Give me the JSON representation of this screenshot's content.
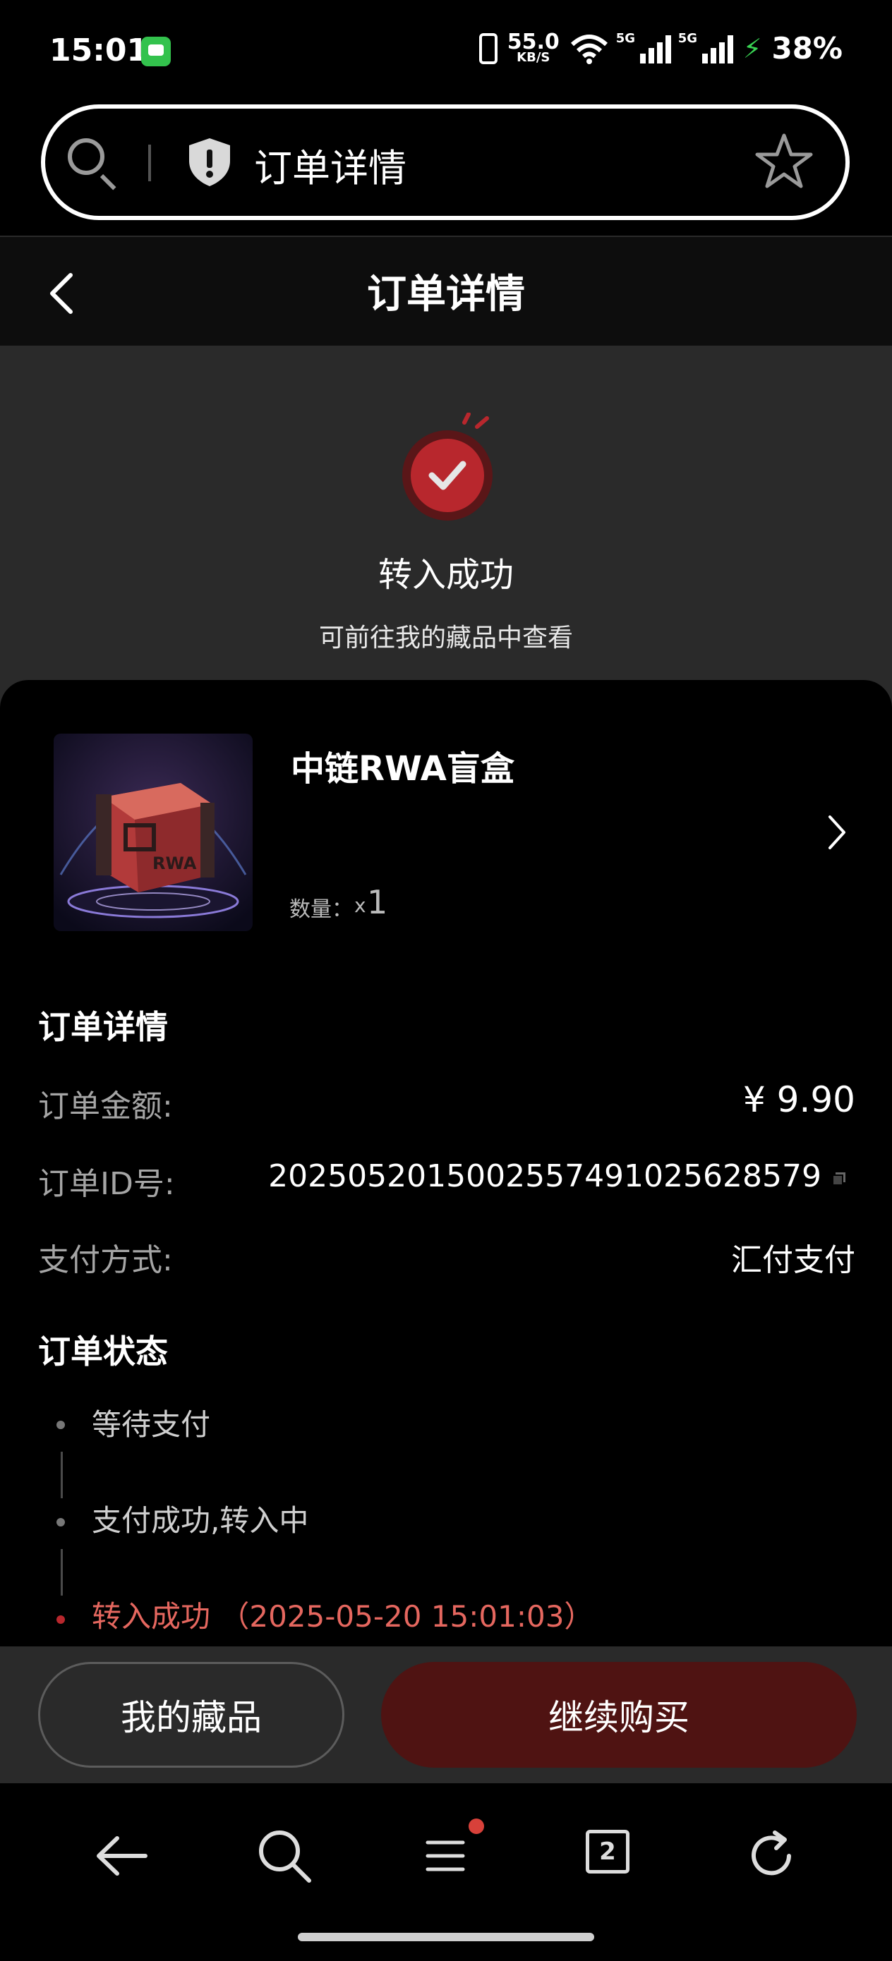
{
  "status_bar": {
    "time": "15:01",
    "net_speed": "55.0",
    "net_speed_unit": "KB/S",
    "sim1_label": "5G",
    "sim2_label": "5G",
    "battery": "38%"
  },
  "browser": {
    "address_text": "订单详情",
    "tab_count": "2"
  },
  "header": {
    "title": "订单详情"
  },
  "result": {
    "title": "转入成功",
    "subtitle": "可前往我的藏品中查看"
  },
  "product": {
    "name": "中链RWA盲盒",
    "qty_label": "数量：",
    "qty_prefix": "x",
    "qty_value": "1",
    "image_logo": "RWA"
  },
  "order_details": {
    "heading": "订单详情",
    "rows": [
      {
        "label": "订单金额:",
        "value": "¥ 9.90"
      },
      {
        "label": "订单ID号:",
        "value": "20250520150025574910256285​79"
      },
      {
        "label": "支付方式:",
        "value": "汇付支付"
      }
    ]
  },
  "order_status": {
    "heading": "订单状态",
    "steps": [
      {
        "text": "等待支付"
      },
      {
        "text": "支付成功,转入中"
      },
      {
        "text": "转入成功 （2025-05-20 15:01:03）"
      }
    ]
  },
  "actions": {
    "my_collection": "我的藏品",
    "continue_buy": "继续购买"
  },
  "colors": {
    "accent_red": "#b8272d",
    "active_step": "#e5675f",
    "continue_button": "#4f1312"
  }
}
